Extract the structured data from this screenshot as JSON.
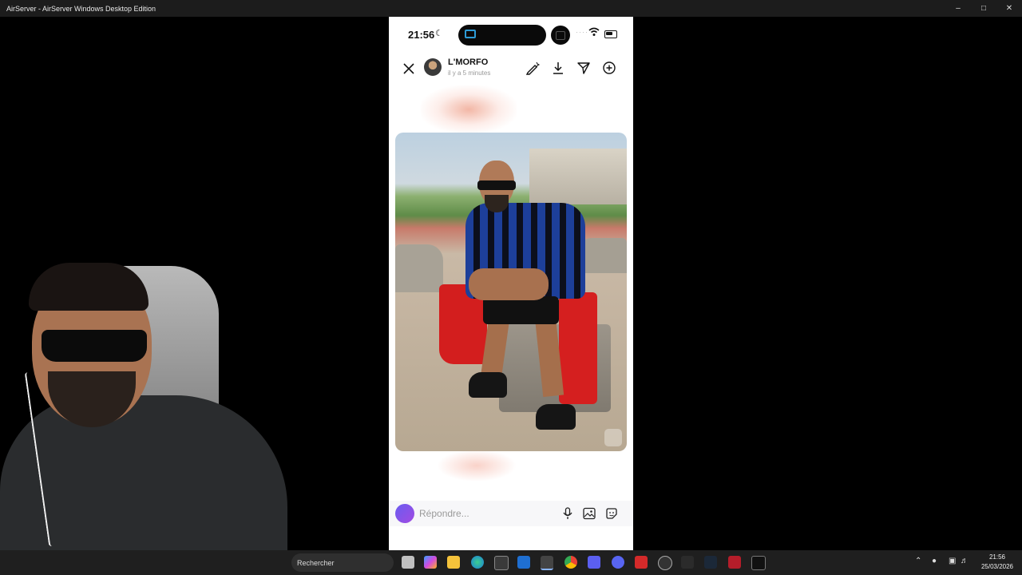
{
  "window": {
    "title": "AirServer - AirServer Windows Desktop Edition"
  },
  "phone": {
    "status": {
      "time": "21:56"
    },
    "header": {
      "username": "L'MORFO",
      "time_ago": "il y a 5 minutes"
    },
    "reply": {
      "placeholder": "Répondre..."
    }
  },
  "taskbar": {
    "search_label": "Rechercher",
    "time": "21:56",
    "date": "25/03/2026"
  },
  "colors": {
    "accent_purple": "#7b4fe0",
    "titlebar": "#1c1c1c",
    "taskbar": "#1f1f1f"
  }
}
